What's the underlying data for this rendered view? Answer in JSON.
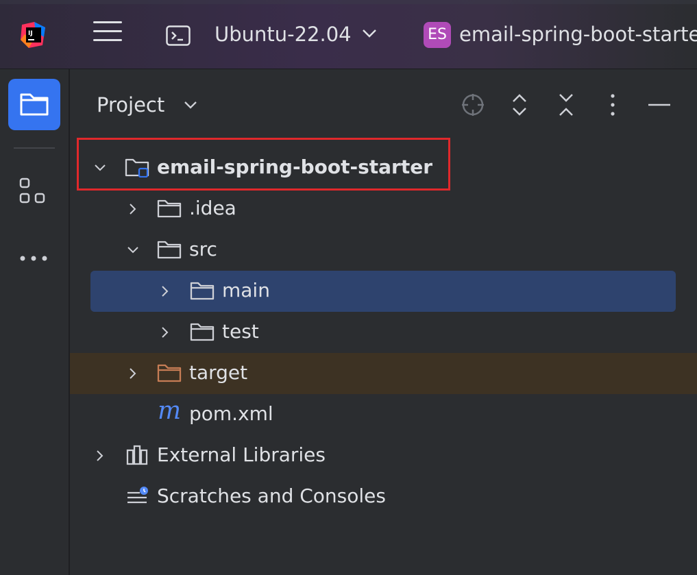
{
  "titlebar": {
    "app_logo": "intellij-logo-icon",
    "menu_icon": "hamburger-menu-icon",
    "terminal_icon": "terminal-icon",
    "distro": "Ubuntu-22.04",
    "project_badge": "ES",
    "project_name": "email-spring-boot-starter",
    "badge_color": "#b04bb8"
  },
  "toolstrip": {
    "items": [
      {
        "name": "project-tool-button",
        "icon": "folder-icon",
        "active": true
      },
      {
        "name": "structure-tool-button",
        "icon": "structure-icon"
      },
      {
        "name": "more-tools-button",
        "icon": "more-horizontal-icon"
      }
    ],
    "accent": "#3574f0"
  },
  "panel": {
    "title": "Project",
    "tools": [
      "locate-icon",
      "expand-all-icon",
      "collapse-all-icon",
      "more-vertical-icon",
      "minimize-icon"
    ]
  },
  "tree": {
    "root": "email-spring-boot-starter",
    "idea": ".idea",
    "src": "src",
    "main": "main",
    "test": "test",
    "target": "target",
    "pom": "pom.xml",
    "external_libraries": "External Libraries",
    "scratches": "Scratches and Consoles"
  },
  "colors": {
    "selection": "#2e436e",
    "excluded_row": "#3d3223",
    "highlight_border": "#e0282b"
  }
}
